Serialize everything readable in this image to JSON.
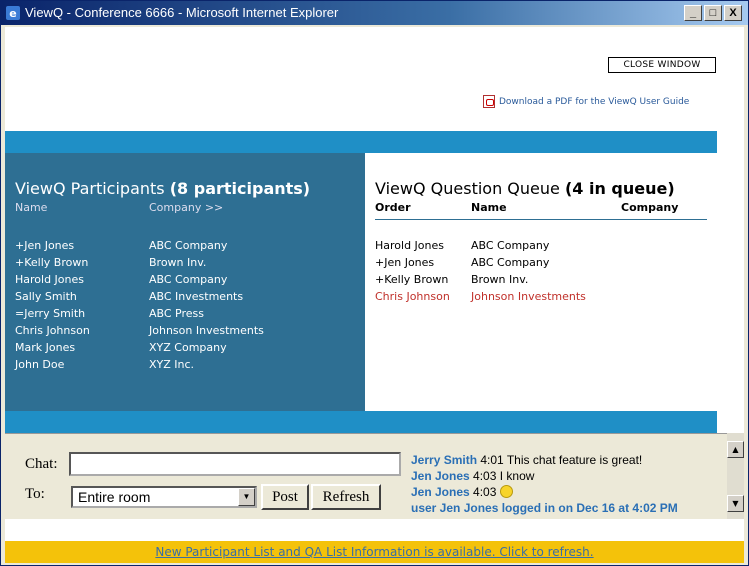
{
  "window": {
    "title": "ViewQ - Conference 6666 - Microsoft Internet Explorer",
    "minimize": "_",
    "maximize": "□",
    "close": "X"
  },
  "header": {
    "close_window": "CLOSE WINDOW",
    "pdf_link": "Download a PDF for the ViewQ User Guide"
  },
  "participants": {
    "title": "ViewQ Participants",
    "count_label": "(8 participants)",
    "col_name": "Name",
    "col_company": "Company >>",
    "rows": [
      {
        "name": "+Jen Jones",
        "company": "ABC Company"
      },
      {
        "name": "+Kelly Brown",
        "company": "Brown Inv."
      },
      {
        "name": "Harold Jones",
        "company": "ABC Company"
      },
      {
        "name": "Sally Smith",
        "company": "ABC Investments"
      },
      {
        "name": "=Jerry Smith",
        "company": "ABC Press"
      },
      {
        "name": "Chris Johnson",
        "company": "Johnson Investments"
      },
      {
        "name": "Mark Jones",
        "company": "XYZ Company"
      },
      {
        "name": "John Doe",
        "company": "XYZ Inc."
      }
    ]
  },
  "queue": {
    "title": "ViewQ Question Queue",
    "count_label": "(4 in queue)",
    "col_order": "Order",
    "col_name": "Name",
    "col_company": "Company",
    "rows": [
      {
        "name": "Harold Jones",
        "company": "ABC Company",
        "highlight": false
      },
      {
        "name": "+Jen Jones",
        "company": "ABC Company",
        "highlight": false
      },
      {
        "name": "+Kelly Brown",
        "company": "Brown Inv.",
        "highlight": false
      },
      {
        "name": "Chris Johnson",
        "company": "Johnson Investments",
        "highlight": true
      }
    ]
  },
  "chat": {
    "chat_label": "Chat:",
    "input_value": "",
    "to_label": "To:",
    "to_selected": "Entire room",
    "post_label": "Post",
    "refresh_label": "Refresh",
    "messages": [
      {
        "who": "Jerry Smith",
        "time": "4:01",
        "text": "This chat feature is great!"
      },
      {
        "who": "Jen Jones",
        "time": "4:03",
        "text": "I know"
      },
      {
        "who": "Jen Jones",
        "time": "4:03",
        "text": "",
        "emoticon": "smiley-icon"
      },
      {
        "system": "user Jen Jones logged in on Dec 16 at 4:02 PM"
      }
    ]
  },
  "notice": {
    "text": "New Participant List and QA List Information is available. Click to refresh."
  },
  "colors": {
    "participants_bg": "#2e6f93",
    "bluebar": "#1f8fc6",
    "highlight_red": "#c0302a",
    "notice_bg": "#f4c20a",
    "chat_name": "#2a6fb5"
  }
}
